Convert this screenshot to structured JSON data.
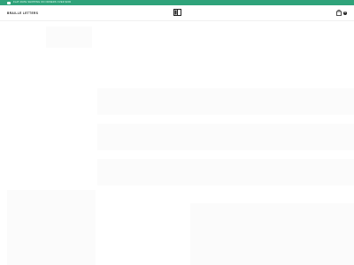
{
  "announcement": {
    "text": "FLAT-RATE SHIPPING ON ORDERS OVER $200",
    "icon": "truck-icon",
    "background": "#2fa37a"
  },
  "header": {
    "nav_link": "BRAILLE LETTERS",
    "logo": "braille-book-logo",
    "cart_icon": "shopping-bag-icon",
    "cart_count": "0"
  },
  "colors": {
    "accent": "#2fa37a",
    "text": "#222222",
    "background": "#ffffff"
  }
}
